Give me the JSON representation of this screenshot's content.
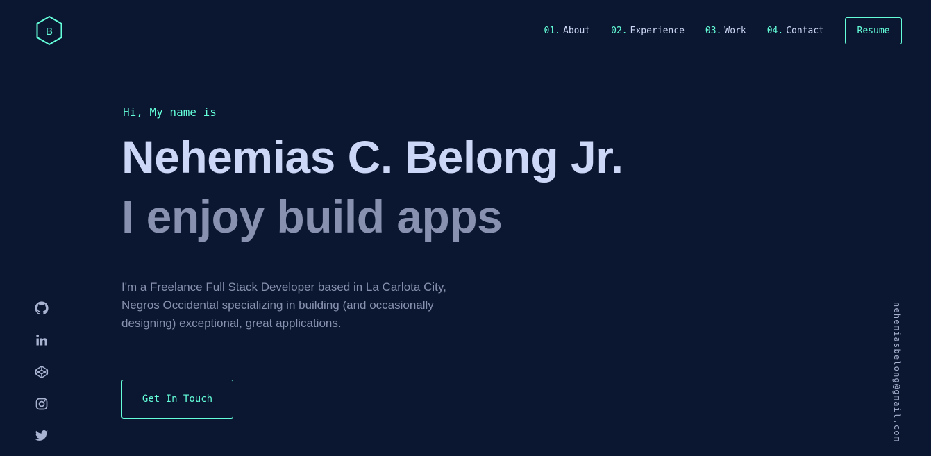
{
  "logo": {
    "letter": "B",
    "icon": "hexagon-logo-icon"
  },
  "nav": {
    "items": [
      {
        "num": "01.",
        "label": "About"
      },
      {
        "num": "02.",
        "label": "Experience"
      },
      {
        "num": "03.",
        "label": "Work"
      },
      {
        "num": "04.",
        "label": "Contact"
      }
    ],
    "resume_label": "Resume"
  },
  "hero": {
    "greeting": "Hi, My name is",
    "name": "Nehemias C. Belong Jr.",
    "tagline": "I enjoy build apps",
    "intro": "I'm a Freelance Full Stack Developer based in La Carlota City, Negros Occidental specializing in building (and occasionally designing) exceptional, great applications.",
    "cta_label": "Get In Touch"
  },
  "socials": [
    "github-icon",
    "linkedin-icon",
    "codepen-icon",
    "instagram-icon",
    "twitter-icon"
  ],
  "email": "nehemiasbelong@gmail.com",
  "colors": {
    "background": "#0b1730",
    "accent": "#64ffda",
    "heading": "#ccd6f6",
    "text": "#8892b0"
  }
}
